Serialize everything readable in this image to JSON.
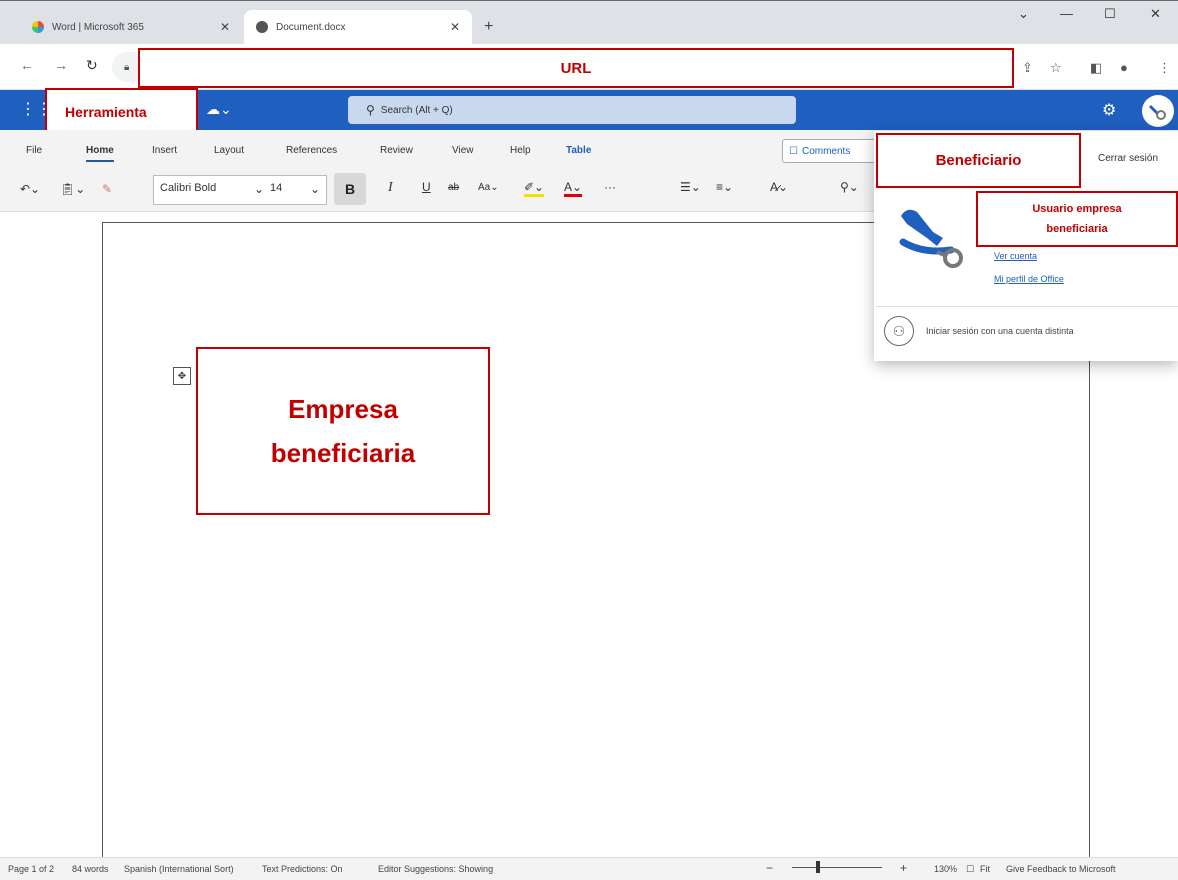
{
  "browser": {
    "tabs": [
      {
        "title": "Word | Microsoft 365",
        "active": false
      },
      {
        "title": "Document.docx",
        "active": true
      }
    ],
    "window_controls": {
      "chevron": "⌄",
      "minimize": "—",
      "maximize": "☐",
      "close": "✕"
    }
  },
  "annotations": {
    "url": "URL",
    "herramienta": "Herramienta",
    "beneficiario": "Beneficiario",
    "usuario_line1": "Usuario empresa",
    "usuario_line2": "beneficiaria",
    "empresa_line1": "Empresa",
    "empresa_line2": "beneficiaria"
  },
  "word": {
    "search_placeholder": "Search (Alt + Q)",
    "ribbon_tabs": [
      "File",
      "Home",
      "Insert",
      "Layout",
      "References",
      "Review",
      "View",
      "Help",
      "Table"
    ],
    "comments_label": "Comments",
    "font_name": "Calibri Bold",
    "font_size": "14",
    "bold_label": "B"
  },
  "account": {
    "sign_out": "Cerrar sesión",
    "view_account": "Ver cuenta",
    "office_profile": "Mi perfil de Office",
    "other_account": "Iniciar sesión con una cuenta distinta"
  },
  "status_bar": {
    "page": "Page 1 of 2",
    "words": "84 words",
    "language": "Spanish (International Sort)",
    "text_predictions": "Text Predictions: On",
    "editor": "Editor Suggestions: Showing",
    "zoom": "130%",
    "fit": "Fit",
    "feedback": "Give Feedback to Microsoft"
  },
  "colors": {
    "word_blue": "#1f5fbf",
    "annotation_red": "#c00000"
  }
}
